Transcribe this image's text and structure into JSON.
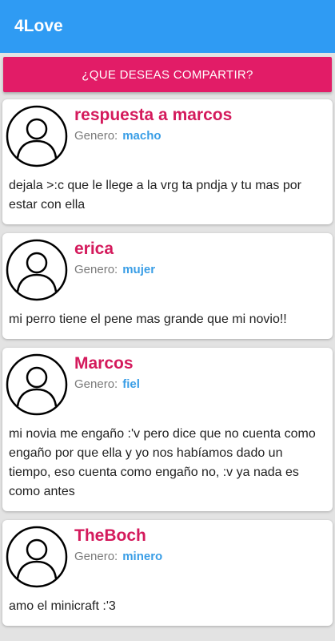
{
  "app": {
    "title": "4Love"
  },
  "share_button": {
    "label": "¿QUE DESEAS COMPARTIR?"
  },
  "colors": {
    "appbar": "#2f9bf3",
    "accent": "#e21c67",
    "author": "#d41a5c",
    "gender_value": "#3a9ee6"
  },
  "posts": [
    {
      "author": "respuesta a marcos",
      "gender_label": "Genero:",
      "gender_value": "macho",
      "text": "dejala >:c que le llege a la vrg ta pndja y tu mas por estar con ella",
      "avatar_icon": "user-avatar-icon"
    },
    {
      "author": "erica",
      "gender_label": "Genero:",
      "gender_value": "mujer",
      "text": "mi perro tiene el pene mas grande que mi novio!!",
      "avatar_icon": "user-avatar-icon"
    },
    {
      "author": "Marcos",
      "gender_label": "Genero:",
      "gender_value": "fiel",
      "text": "mi novia me engaño :'v pero dice que no cuenta como engaño por que ella y yo nos habíamos dado un tiempo, eso cuenta como engaño no, :v ya nada es como antes",
      "avatar_icon": "user-avatar-icon"
    },
    {
      "author": "TheBoch",
      "gender_label": "Genero:",
      "gender_value": "minero",
      "text": "amo el minicraft :'3",
      "avatar_icon": "user-avatar-icon"
    }
  ]
}
